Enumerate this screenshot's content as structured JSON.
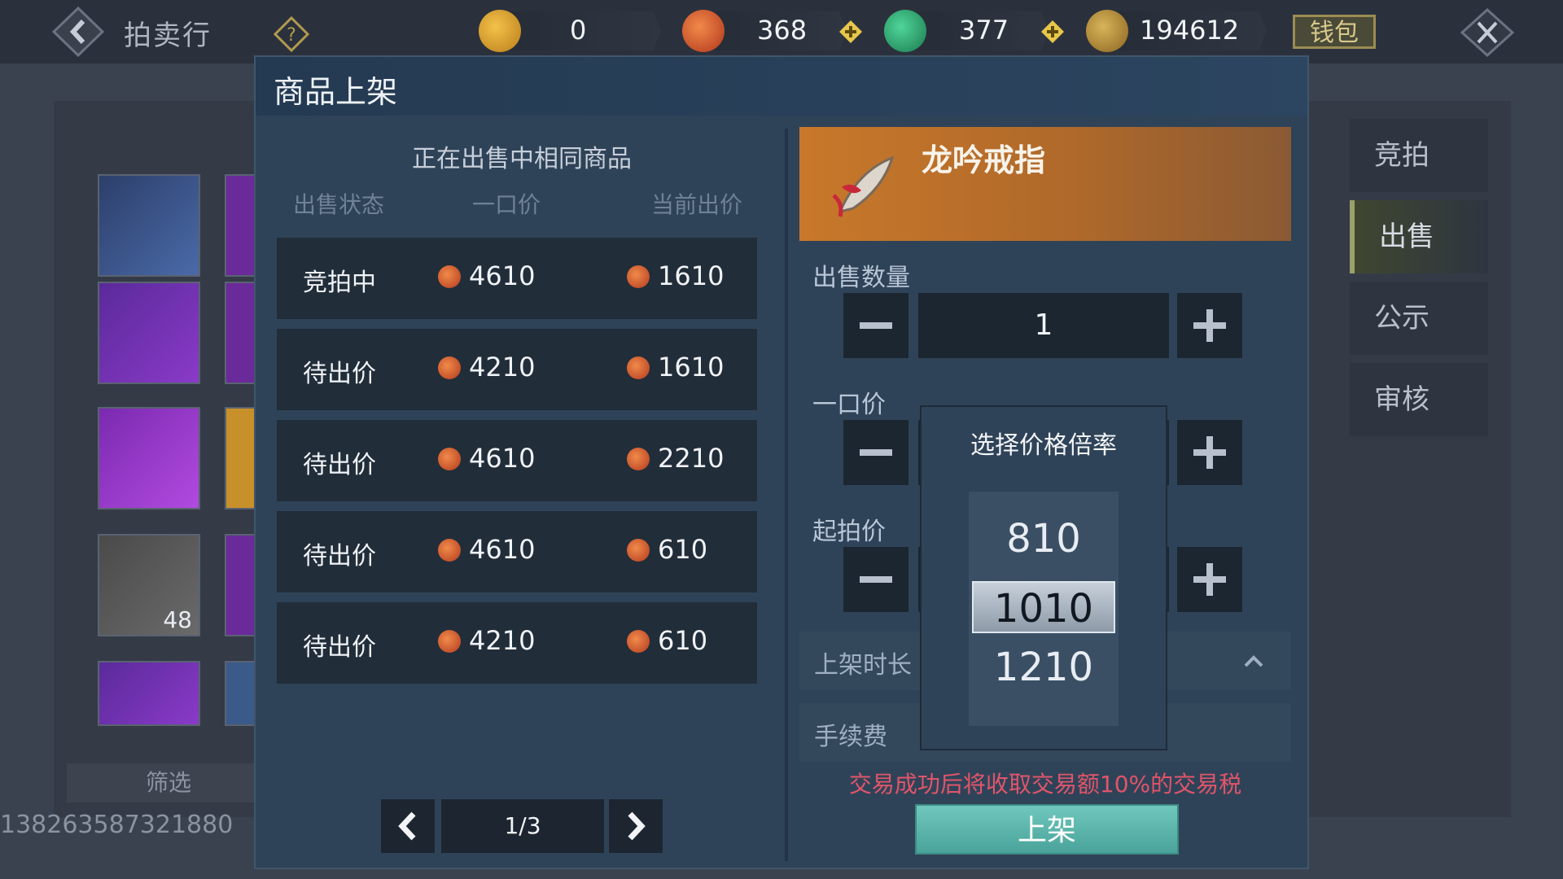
{
  "topbar": {
    "title": "拍卖行",
    "currencies": [
      {
        "icon": "gold-ingot-icon",
        "value": "0"
      },
      {
        "icon": "red-swirl-coin-icon",
        "value": "368"
      },
      {
        "icon": "jade-coin-icon",
        "value": "377"
      },
      {
        "icon": "copper-coin-icon",
        "value": "194612"
      }
    ],
    "wallet_label": "钱包"
  },
  "background": {
    "item_count_label": "48",
    "filter_label": "筛选",
    "account_id": "138263587321880"
  },
  "right_tabs": [
    {
      "label": "竞拍",
      "active": false
    },
    {
      "label": "出售",
      "active": true
    },
    {
      "label": "公示",
      "active": false
    },
    {
      "label": "审核",
      "active": false
    }
  ],
  "modal": {
    "title": "商品上架",
    "listing": {
      "subtitle": "正在出售中相同商品",
      "columns": [
        "出售状态",
        "一口价",
        "当前出价"
      ],
      "rows": [
        {
          "status": "竞拍中",
          "buyout": "4610",
          "bid": "1610"
        },
        {
          "status": "待出价",
          "buyout": "4210",
          "bid": "1610"
        },
        {
          "status": "待出价",
          "buyout": "4610",
          "bid": "2210"
        },
        {
          "status": "待出价",
          "buyout": "4610",
          "bid": "610"
        },
        {
          "status": "待出价",
          "buyout": "4210",
          "bid": "610"
        }
      ],
      "page": "1/3"
    },
    "item": {
      "name": "龙吟戒指",
      "qty_label": "出售数量",
      "qty_value": "1",
      "buyout_label": "一口价",
      "start_label": "起拍价",
      "duration_label": "上架时长",
      "fee_label": "手续费",
      "tax_note": "交易成功后将收取交易额10%的交易税",
      "submit_label": "上架"
    },
    "picker": {
      "title": "选择价格倍率",
      "options": [
        "810",
        "1010",
        "1210"
      ],
      "selected": "1010"
    }
  }
}
